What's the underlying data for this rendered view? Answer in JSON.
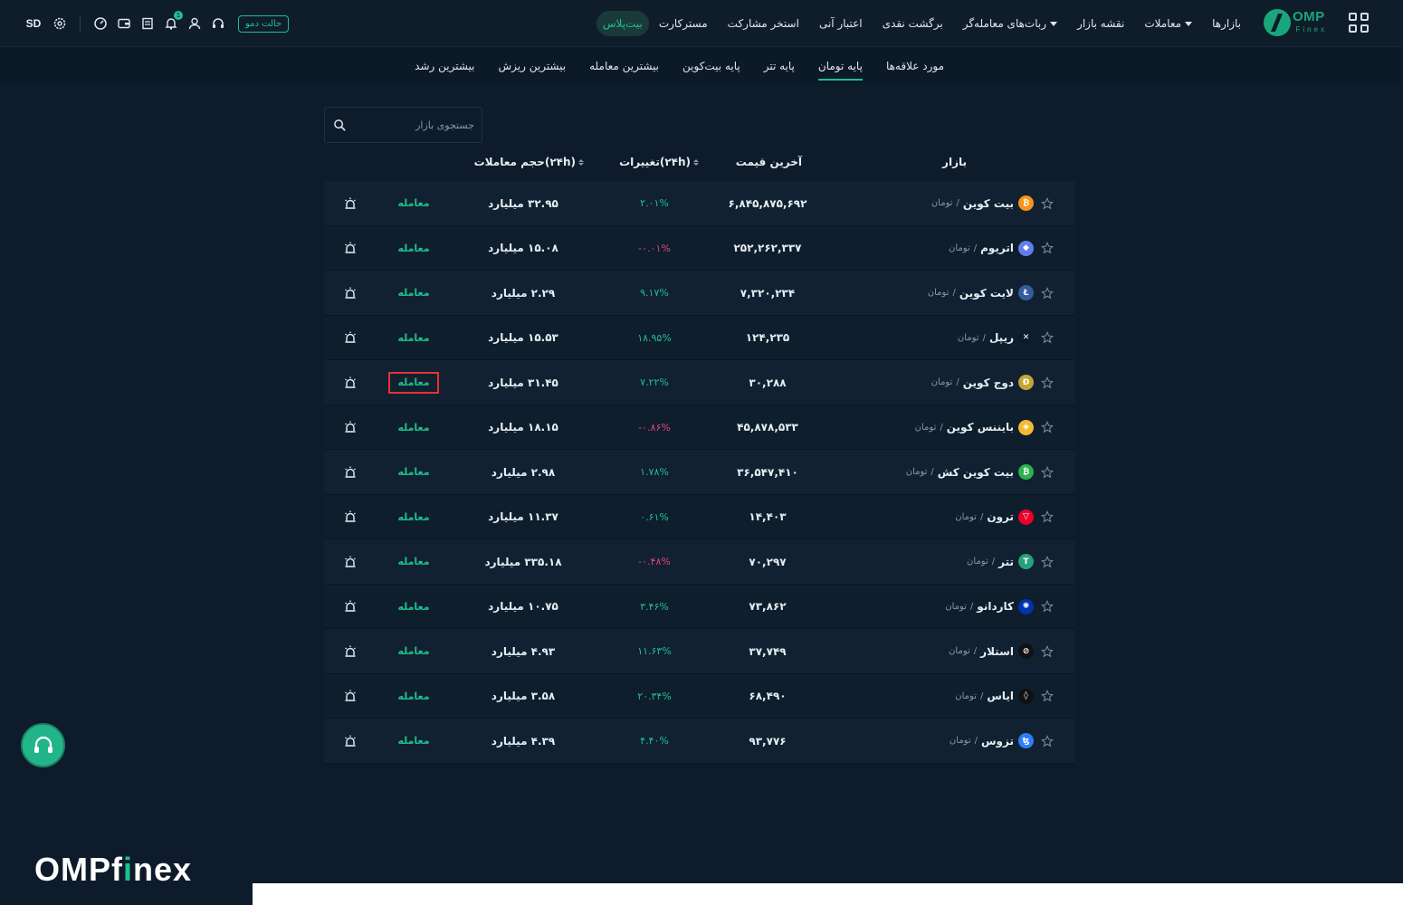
{
  "header": {
    "logo_text": "OMP",
    "logo_sub": "Finex",
    "nav": [
      {
        "label": "بازارها",
        "caret": false
      },
      {
        "label": "معاملات",
        "caret": true
      },
      {
        "label": "نقشه بازار",
        "caret": false
      },
      {
        "label": "ربات‌های معامله‌گر",
        "caret": true
      },
      {
        "label": "برگشت نقدی",
        "caret": false
      },
      {
        "label": "اعتبار آنی",
        "caret": false
      },
      {
        "label": "استخر مشارکت",
        "caret": false
      },
      {
        "label": "مسترکارت",
        "caret": false
      },
      {
        "label": "بیت‌پلاس",
        "caret": false,
        "pill": true
      }
    ],
    "demo_label": "حالت دمو",
    "notification_count": "1",
    "language_label": "SD"
  },
  "subtabs": [
    {
      "label": "مورد علاقه‌ها",
      "active": false
    },
    {
      "label": "پایه تومان",
      "active": true
    },
    {
      "label": "پایه تتر",
      "active": false
    },
    {
      "label": "پایه بیت‌کوین",
      "active": false
    },
    {
      "label": "بیشترین معامله",
      "active": false
    },
    {
      "label": "بیشترین ریزش",
      "active": false
    },
    {
      "label": "بیشترین رشد",
      "active": false
    }
  ],
  "search": {
    "placeholder": "جستجوی بازار"
  },
  "table": {
    "headers": {
      "market": "بازار",
      "last_price": "آخرین قیمت",
      "change": "تغییرات(۲۴h)",
      "volume": "حجم معاملات(۲۴h)"
    },
    "trade_label": "معامله",
    "quote_label": "تومان",
    "rows": [
      {
        "name": "بیت کوین",
        "price": "۶,۸۴۵,۸۷۵,۶۹۲",
        "change": "۲.۰۱%",
        "dir": "pos",
        "volume": "۳۲.۹۵ میلیارد",
        "coin_color": "#f7931a",
        "coin_glyph": "₿"
      },
      {
        "name": "اتریوم",
        "price": "۲۵۲,۲۶۲,۳۳۷",
        "change": "-۰.۰۱%",
        "dir": "neg",
        "volume": "۱۵.۰۸ میلیارد",
        "coin_color": "#627eea",
        "coin_glyph": "◆"
      },
      {
        "name": "لایت کوین",
        "price": "۷,۳۲۰,۲۳۴",
        "change": "۹.۱۷%",
        "dir": "pos",
        "volume": "۲.۲۹ میلیارد",
        "coin_color": "#345d9d",
        "coin_glyph": "Ł"
      },
      {
        "name": "ریپل",
        "price": "۱۲۴,۲۳۵",
        "change": "۱۸.۹۵%",
        "dir": "pos",
        "volume": "۱۵.۵۳ میلیارد",
        "coin_color": "#0d1b2a",
        "coin_glyph": "✕"
      },
      {
        "name": "دوج کوین",
        "price": "۳۰,۲۸۸",
        "change": "۷.۲۲%",
        "dir": "pos",
        "volume": "۳۱.۴۵ میلیارد",
        "coin_color": "#c2a633",
        "coin_glyph": "Ð"
      },
      {
        "name": "بایننس کوین",
        "price": "۴۵,۸۷۸,۵۳۳",
        "change": "-۰.۸۶%",
        "dir": "neg",
        "volume": "۱۸.۱۵ میلیارد",
        "coin_color": "#f3ba2f",
        "coin_glyph": "◈"
      },
      {
        "name": "بیت کوین کش",
        "price": "۳۶,۵۴۷,۴۱۰",
        "change": "۱.۷۸%",
        "dir": "pos",
        "volume": "۲.۹۸ میلیارد",
        "coin_color": "#2bb24c",
        "coin_glyph": "₿"
      },
      {
        "name": "ترون",
        "price": "۱۴,۴۰۳",
        "change": "۰.۶۱%",
        "dir": "pos",
        "volume": "۱۱.۳۷ میلیارد",
        "coin_color": "#eb0029",
        "coin_glyph": "▽"
      },
      {
        "name": "تتر",
        "price": "۷۰,۲۹۷",
        "change": "-۰.۴۸%",
        "dir": "neg",
        "volume": "۳۳۵.۱۸ میلیارد",
        "coin_color": "#26a17b",
        "coin_glyph": "T"
      },
      {
        "name": "کاردانو",
        "price": "۷۳,۸۶۲",
        "change": "۳.۴۶%",
        "dir": "pos",
        "volume": "۱۰.۷۵ میلیارد",
        "coin_color": "#0033ad",
        "coin_glyph": "✺"
      },
      {
        "name": "استلار",
        "price": "۳۷,۷۴۹",
        "change": "۱۱.۶۳%",
        "dir": "pos",
        "volume": "۴.۹۳ میلیارد",
        "coin_color": "#111111",
        "coin_glyph": "⊘"
      },
      {
        "name": "ایاس",
        "price": "۶۸,۴۹۰",
        "change": "۲۰.۳۴%",
        "dir": "pos",
        "volume": "۳.۵۸ میلیارد",
        "coin_color": "#111111",
        "coin_glyph": "◊"
      },
      {
        "name": "تزوس",
        "price": "۹۳,۷۷۶",
        "change": "۴.۴۰%",
        "dir": "pos",
        "volume": "۴.۳۹ میلیارد",
        "coin_color": "#2c7df7",
        "coin_glyph": "ꜩ"
      }
    ]
  },
  "brand": {
    "part1": "OMPf",
    "part2": "i",
    "part3": "nex"
  },
  "colors": {
    "accent": "#1fbf8f",
    "negative": "#e0457b",
    "background": "#0d1b2a",
    "highlight": "#e53333"
  }
}
